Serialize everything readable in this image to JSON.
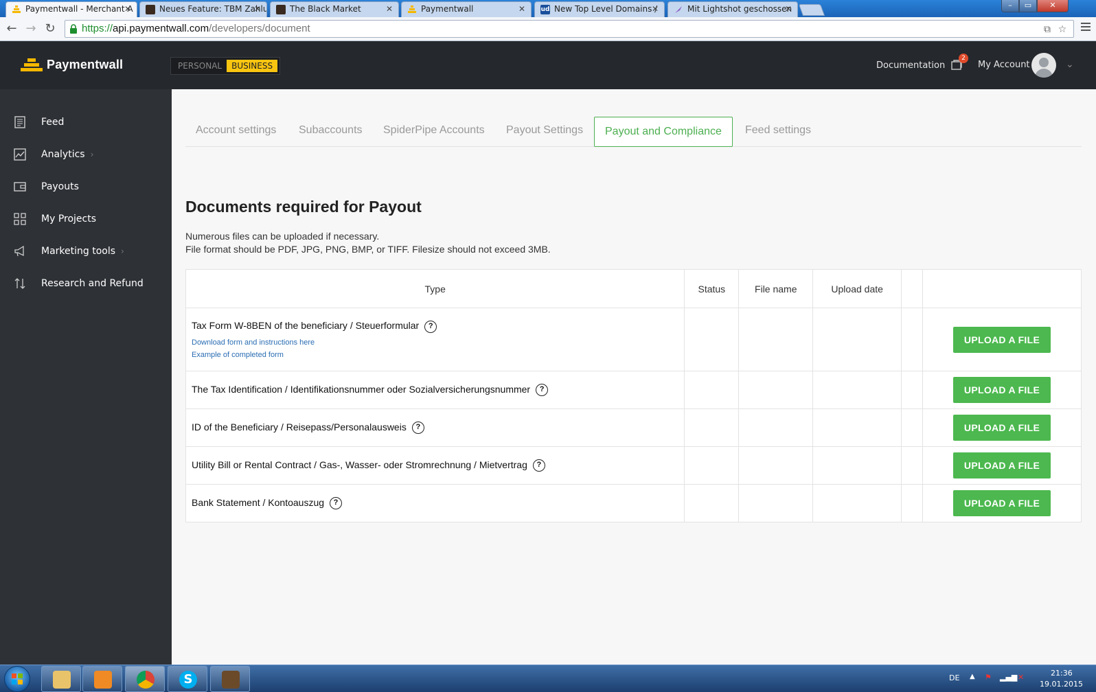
{
  "browser": {
    "tabs": [
      {
        "title": "Paymentwall - Merchant A",
        "active": true
      },
      {
        "title": "Neues Feature: TBM Zahlu",
        "active": false
      },
      {
        "title": "The Black Market",
        "active": false
      },
      {
        "title": "Paymentwall",
        "active": false
      },
      {
        "title": "New Top Level Domains /",
        "active": false
      },
      {
        "title": "Mit Lightshot geschossen",
        "active": false
      }
    ],
    "url_scheme": "https://",
    "url_host": "api.paymentwall.com",
    "url_path": "/developers/document"
  },
  "header": {
    "logo_text": "Paymentwall",
    "mode_personal": "PERSONAL",
    "mode_business": "BUSINESS",
    "documentation": "Documentation",
    "notification_count": "2",
    "my_account": "My Account"
  },
  "sidebar": {
    "items": [
      {
        "label": "Feed",
        "icon": "feed-icon",
        "has_arrow": false
      },
      {
        "label": "Analytics",
        "icon": "analytics-icon",
        "has_arrow": true
      },
      {
        "label": "Payouts",
        "icon": "wallet-icon",
        "has_arrow": false
      },
      {
        "label": "My Projects",
        "icon": "grid-icon",
        "has_arrow": false
      },
      {
        "label": "Marketing tools",
        "icon": "megaphone-icon",
        "has_arrow": true
      },
      {
        "label": "Research and Refund",
        "icon": "arrows-updown-icon",
        "has_arrow": false
      }
    ]
  },
  "main": {
    "tabs": [
      {
        "label": "Account settings",
        "active": false
      },
      {
        "label": "Subaccounts",
        "active": false
      },
      {
        "label": "SpiderPipe Accounts",
        "active": false
      },
      {
        "label": "Payout Settings",
        "active": false
      },
      {
        "label": "Payout and Compliance",
        "active": true
      },
      {
        "label": "Feed settings",
        "active": false
      }
    ],
    "title": "Documents required for Payout",
    "desc_line1": "Numerous files can be uploaded if necessary.",
    "desc_line2": "File format should be PDF, JPG, PNG, BMP, or TIFF. Filesize should not exceed 3MB.",
    "table": {
      "headers": {
        "type": "Type",
        "status": "Status",
        "file_name": "File name",
        "upload_date": "Upload date"
      },
      "rows": [
        {
          "type": "Tax Form W-8BEN of the beneficiary / Steuerformular",
          "link1": "Download form and instructions here",
          "link2": "Example of completed form",
          "button": "UPLOAD A FILE"
        },
        {
          "type": "The Tax Identification / Identifikationsnummer oder Sozialversicherungsnummer",
          "button": "UPLOAD A FILE"
        },
        {
          "type": "ID of the Beneficiary / Reisepass/Personalausweis",
          "button": "UPLOAD A FILE"
        },
        {
          "type": "Utility Bill or Rental Contract / Gas-, Wasser- oder Stromrechnung / Mietvertrag",
          "button": "UPLOAD A FILE"
        },
        {
          "type": "Bank Statement / Kontoauszug",
          "button": "UPLOAD A FILE"
        }
      ]
    }
  },
  "taskbar": {
    "language": "DE",
    "time": "21:36",
    "date": "19.01.2015"
  },
  "colors": {
    "accent_green": "#4cb84f",
    "sidebar_bg": "#2e3136",
    "header_bg": "#25282c",
    "business_yellow": "#f9c511"
  }
}
